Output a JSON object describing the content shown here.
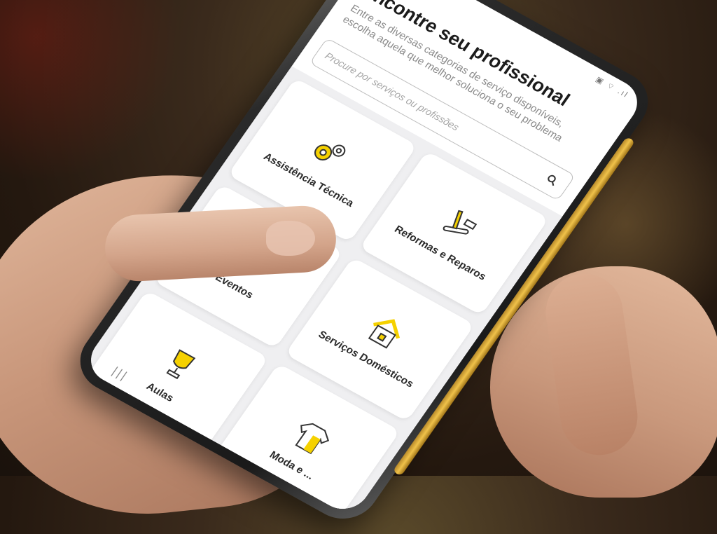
{
  "app": {
    "title": "Encontre seu profissional",
    "subtitle": "Entre as diversas categorias de serviço disponíveis, escolha aquela que melhor soluciona o seu problema",
    "back_icon": "arrow-left-icon",
    "status_icons": "▣ ⌔ .ıl"
  },
  "search": {
    "placeholder": "Procure por serviços ou profissões",
    "icon": "search-icon"
  },
  "categories": [
    {
      "label": "Assistência Técnica",
      "icon": "gears-icon"
    },
    {
      "label": "Reformas e Reparos",
      "icon": "tools-icon"
    },
    {
      "label": "Eventos",
      "icon": "champagne-glasses-icon"
    },
    {
      "label": "Serviços Domésticos",
      "icon": "house-icon"
    },
    {
      "label": "Aulas",
      "icon": "trophy-icon"
    },
    {
      "label": "Moda e ...",
      "icon": "shirt-icon"
    }
  ],
  "nav": {
    "recent_apps_glyph": "|||"
  },
  "colors": {
    "accent": "#f5d100",
    "card_bg": "#ffffff",
    "grid_bg": "#efeff1"
  }
}
